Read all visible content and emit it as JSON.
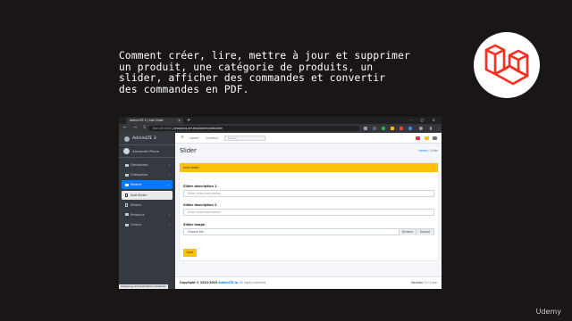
{
  "headline": {
    "line1": "Comment créer, lire, mettre à jour et supprimer",
    "line2": "un produit, une catégorie de produits, un",
    "line3": "slider, afficher des commandes et convertir",
    "line4": "des commandes en PDF."
  },
  "watermark": "Udemy",
  "colors": {
    "laravel_red": "#ff2d20",
    "accent_yellow": "#ffc107",
    "sidebar_bg": "#343a40",
    "active_blue": "#007bff"
  },
  "browser": {
    "tab_title": "AdminLTE 3 | Add Slider",
    "tab_close": "×",
    "new_tab": "+",
    "window_controls": "– ▢ ×",
    "nav_buttons": "← → C",
    "security_label": "Non sécurisé",
    "url": "shopping-art.test/admin/addslider",
    "status_url": "shopping-art.test/admin/addslider"
  },
  "sidebar": {
    "brand": "AdminLTE 3",
    "user": "Alexander Pierce",
    "items": [
      {
        "label": "Dashboard"
      },
      {
        "label": "Categories"
      },
      {
        "label": "Sliders"
      },
      {
        "label": "Add Slider"
      },
      {
        "label": "Sliders"
      },
      {
        "label": "Products"
      },
      {
        "label": "Orders"
      }
    ]
  },
  "topnav": {
    "menu_icon": "≡",
    "home": "Home",
    "contact": "Contact",
    "search_placeholder": "Search"
  },
  "page": {
    "title": "Slider",
    "breadcrumb_home": "Home",
    "breadcrumb_sep": "/",
    "breadcrumb_current": "Slider"
  },
  "form": {
    "header": "Add slider",
    "label1": "Slider description 1",
    "placeholder1": "Enter slider description",
    "label2": "Slider description 2",
    "placeholder2": "Enter slider description",
    "label3": "Slider image",
    "file_text": "Choose file",
    "browse": "Browse",
    "upload": "Upload",
    "submit": "Save"
  },
  "footer": {
    "copyright": "Copyright © 2014-2019",
    "link": "AdminLTE.io.",
    "rights": "All rights reserved.",
    "version_label": "Version",
    "version": "3.0.0-pre"
  }
}
